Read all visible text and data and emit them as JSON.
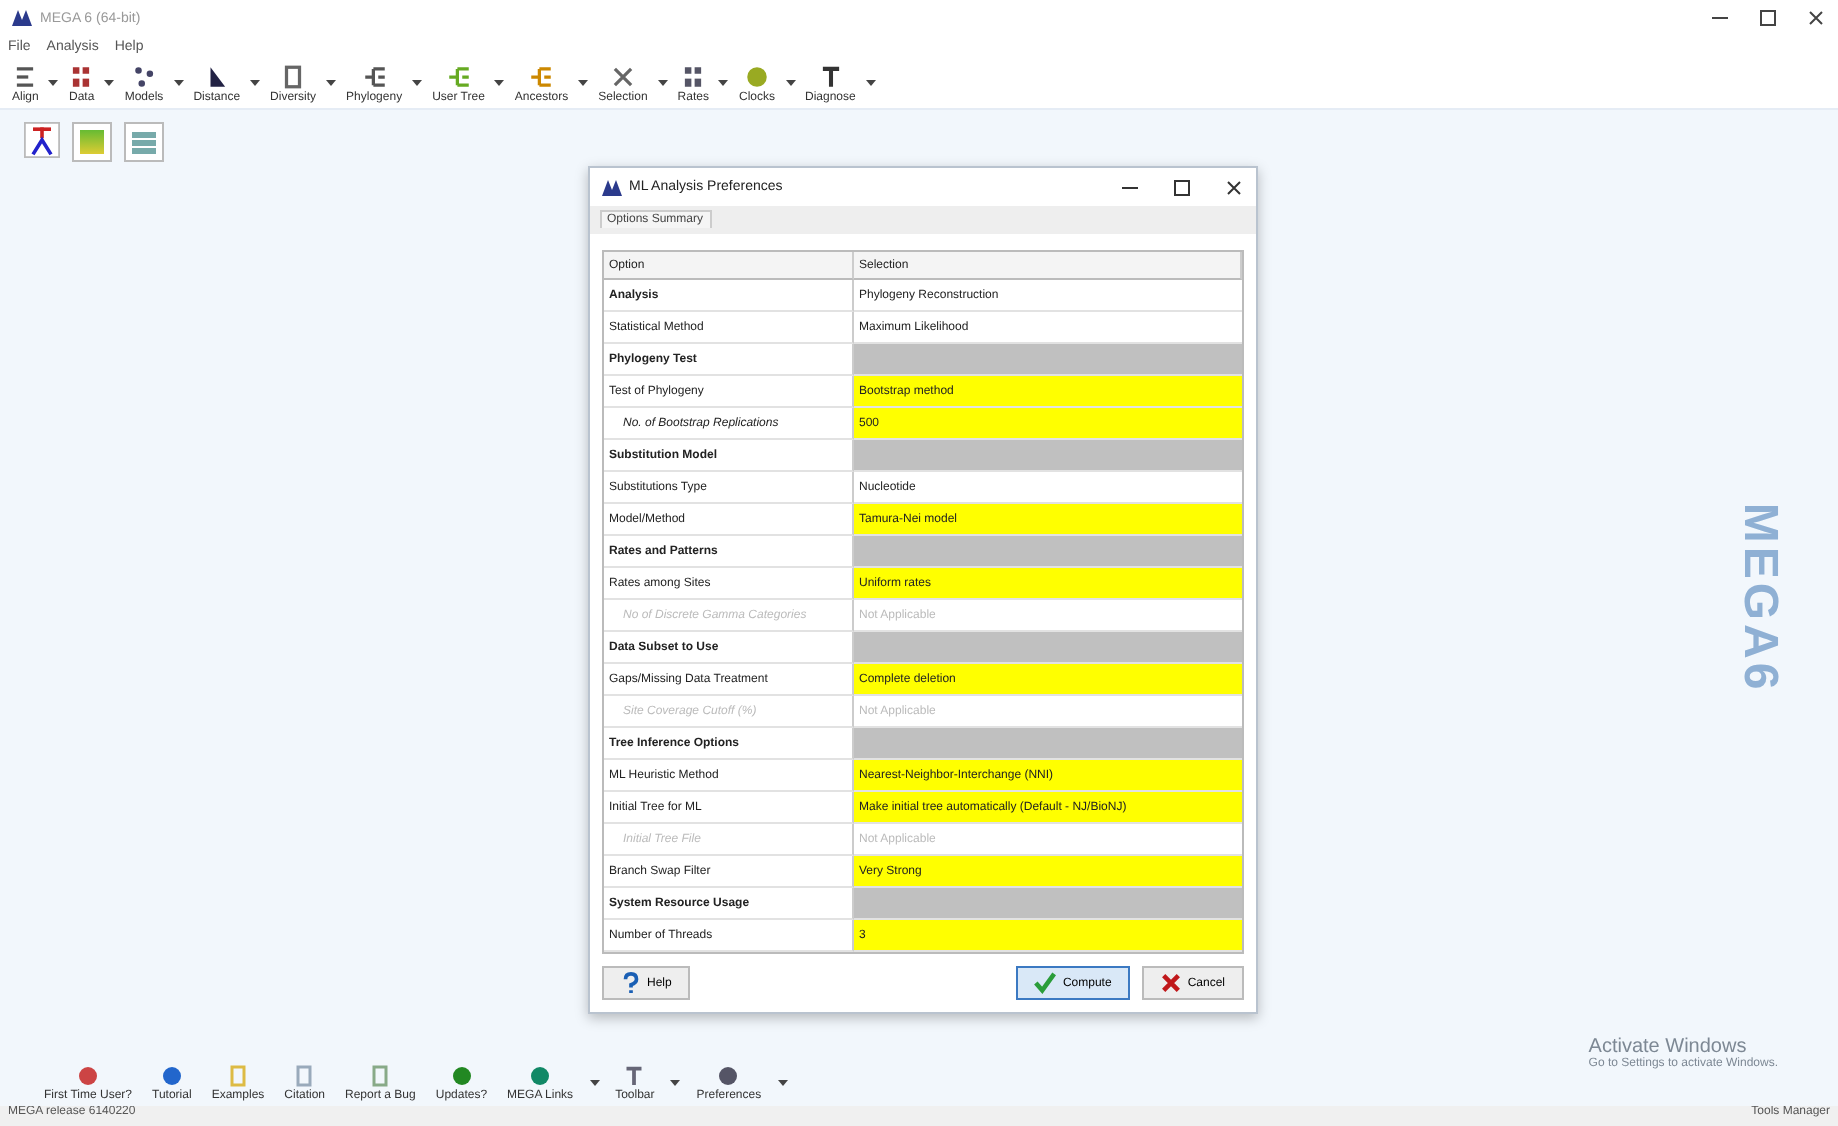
{
  "window": {
    "title": "MEGA 6 (64-bit)"
  },
  "menu": [
    "File",
    "Analysis",
    "Help"
  ],
  "toolbar": [
    {
      "label": "Align",
      "dropdown": true
    },
    {
      "label": "Data",
      "dropdown": true
    },
    {
      "label": "Models",
      "dropdown": true
    },
    {
      "label": "Distance",
      "dropdown": true
    },
    {
      "label": "Diversity",
      "dropdown": true
    },
    {
      "label": "Phylogeny",
      "dropdown": true
    },
    {
      "label": "User Tree",
      "dropdown": true
    },
    {
      "label": "Ancestors",
      "dropdown": true
    },
    {
      "label": "Selection",
      "dropdown": true
    },
    {
      "label": "Rates",
      "dropdown": true
    },
    {
      "label": "Clocks",
      "dropdown": true
    },
    {
      "label": "Diagnose",
      "dropdown": true
    }
  ],
  "side_label": "MEGA6",
  "dialog": {
    "title": "ML Analysis Preferences",
    "tab": "Options Summary",
    "columns": [
      "Option",
      "Selection"
    ],
    "rows": [
      {
        "kind": "section",
        "option": "Analysis",
        "selection": "Phylogeny Reconstruction",
        "disabled": false,
        "highlighted": false
      },
      {
        "kind": "option",
        "option": "Statistical Method",
        "selection": "Maximum Likelihood",
        "disabled": false,
        "highlighted": false
      },
      {
        "kind": "section",
        "option": "Phylogeny Test",
        "disabled": false,
        "highlighted": false
      },
      {
        "kind": "option",
        "option": "Test of Phylogeny",
        "selection": "Bootstrap method",
        "disabled": false,
        "highlighted": true
      },
      {
        "kind": "suboption",
        "option": "No. of Bootstrap Replications",
        "selection": "500",
        "disabled": false,
        "highlighted": true
      },
      {
        "kind": "section",
        "option": "Substitution Model",
        "disabled": false,
        "highlighted": false
      },
      {
        "kind": "option",
        "option": "Substitutions Type",
        "selection": "Nucleotide",
        "disabled": false,
        "highlighted": false
      },
      {
        "kind": "option",
        "option": "Model/Method",
        "selection": "Tamura-Nei model",
        "disabled": false,
        "highlighted": true
      },
      {
        "kind": "section",
        "option": "Rates and Patterns",
        "disabled": false,
        "highlighted": false
      },
      {
        "kind": "option",
        "option": "Rates among Sites",
        "selection": "Uniform rates",
        "disabled": false,
        "highlighted": true
      },
      {
        "kind": "suboption",
        "option": "No of Discrete Gamma Categories",
        "selection": "Not Applicable",
        "disabled": true,
        "highlighted": false
      },
      {
        "kind": "section",
        "option": "Data Subset to Use",
        "disabled": false,
        "highlighted": false
      },
      {
        "kind": "option",
        "option": "Gaps/Missing Data Treatment",
        "selection": "Complete deletion",
        "disabled": false,
        "highlighted": true
      },
      {
        "kind": "suboption",
        "option": "Site Coverage Cutoff (%)",
        "selection": "Not Applicable",
        "disabled": true,
        "highlighted": false
      },
      {
        "kind": "section",
        "option": "Tree Inference Options",
        "disabled": false,
        "highlighted": false
      },
      {
        "kind": "option",
        "option": "ML Heuristic Method",
        "selection": "Nearest-Neighbor-Interchange (NNI)",
        "disabled": false,
        "highlighted": true
      },
      {
        "kind": "option",
        "option": "Initial Tree for ML",
        "selection": "Make initial tree automatically (Default - NJ/BioNJ)",
        "disabled": false,
        "highlighted": true
      },
      {
        "kind": "suboption",
        "option": "Initial Tree File",
        "selection": "Not Applicable",
        "disabled": true,
        "highlighted": false
      },
      {
        "kind": "option",
        "option": "Branch Swap Filter",
        "selection": "Very Strong",
        "disabled": false,
        "highlighted": true
      },
      {
        "kind": "section",
        "option": "System Resource Usage",
        "disabled": false,
        "highlighted": false
      },
      {
        "kind": "option",
        "option": "Number of Threads",
        "selection": "3",
        "disabled": false,
        "highlighted": true
      }
    ],
    "buttons": [
      {
        "kind": "help",
        "label": "Help"
      },
      {
        "kind": "compute",
        "label": "Compute"
      },
      {
        "kind": "cancel",
        "label": "Cancel"
      }
    ]
  },
  "launcher": [
    {
      "label": "First Time User?",
      "dropdown": false
    },
    {
      "label": "Tutorial",
      "dropdown": false
    },
    {
      "label": "Examples",
      "dropdown": false
    },
    {
      "label": "Citation",
      "dropdown": false
    },
    {
      "label": "Report a Bug",
      "dropdown": false
    },
    {
      "label": "Updates?",
      "dropdown": false
    },
    {
      "label": "MEGA Links",
      "dropdown": true
    },
    {
      "label": "Toolbar",
      "dropdown": true
    },
    {
      "label": "Preferences",
      "dropdown": true
    }
  ],
  "activation": {
    "title": "Activate Windows",
    "hint": "Go to Settings to activate Windows."
  },
  "status_bar": [
    "MEGA release 6140220",
    "Tools Manager"
  ]
}
